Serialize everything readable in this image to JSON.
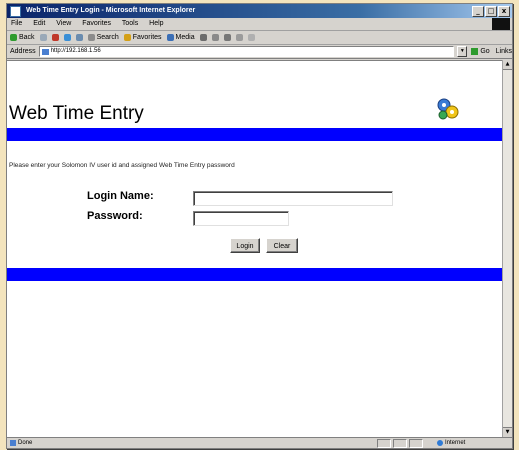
{
  "window": {
    "title": "Web Time Entry Login - Microsoft Internet Explorer",
    "buttons": [
      "_",
      "□",
      "x"
    ]
  },
  "menubar": {
    "items": [
      "File",
      "Edit",
      "View",
      "Favorites",
      "Tools",
      "Help"
    ]
  },
  "toolbar": {
    "back": "Back",
    "search": "Search",
    "favorites": "Favorites",
    "media": "Media"
  },
  "addressbar": {
    "label": "Address",
    "url": "http://192.168.1.56",
    "go": "Go",
    "links": "Links"
  },
  "page": {
    "title": "Web Time Entry",
    "instruction": "Please enter your Solomon IV user id and assigned Web Time Entry password",
    "login_label": "Login Name:",
    "login_value": "",
    "password_label": "Password:",
    "password_value": "",
    "login_button": "Login",
    "clear_button": "Clear"
  },
  "statusbar": {
    "status": "Done",
    "zone": "Internet"
  },
  "colors": {
    "bar": "#0000ff",
    "titlebar_start": "#0a246a"
  }
}
